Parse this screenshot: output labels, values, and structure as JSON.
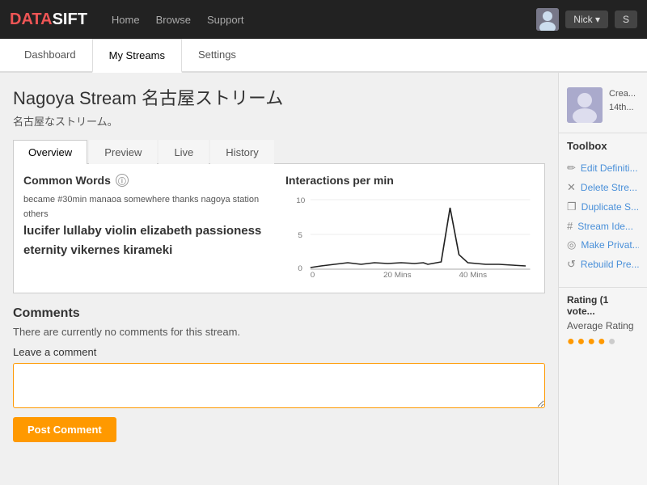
{
  "header": {
    "logo_data": "DATA",
    "logo_sift": "SIFT",
    "nav": [
      {
        "label": "Home",
        "id": "home"
      },
      {
        "label": "Browse",
        "id": "browse"
      },
      {
        "label": "Support",
        "id": "support"
      }
    ],
    "user_label": "Nick ▾",
    "search_placeholder": "Search..."
  },
  "main_tabs": [
    {
      "label": "Dashboard",
      "id": "dashboard",
      "active": false
    },
    {
      "label": "My Streams",
      "id": "my-streams",
      "active": true
    },
    {
      "label": "Settings",
      "id": "settings",
      "active": false
    }
  ],
  "page": {
    "title": "Nagoya Stream 名古屋ストリーム",
    "subtitle": "名古屋なストリーム。"
  },
  "inner_tabs": [
    {
      "label": "Overview",
      "id": "overview",
      "active": true
    },
    {
      "label": "Preview",
      "id": "preview",
      "active": false
    },
    {
      "label": "Live",
      "id": "live",
      "active": false
    },
    {
      "label": "History",
      "id": "history",
      "active": false
    }
  ],
  "overview": {
    "common_words_title": "Common Words",
    "word_cloud_text": "became #30min manaoa somewhere thanks nagoya station others",
    "word_cloud_highlight": "lucifer lullaby violin elizabeth passioness eternity vikernes kirameki",
    "interactions_title": "Interactions per min",
    "chart": {
      "y_labels": [
        "10",
        "5",
        "0"
      ],
      "x_labels": [
        "0",
        "20 Mins",
        "40 Mins"
      ],
      "data_points": [
        0,
        1,
        2,
        1,
        2,
        1,
        1,
        2,
        1,
        1,
        2,
        1,
        2,
        1,
        9,
        3,
        1,
        1,
        1,
        1
      ]
    }
  },
  "comments": {
    "title": "Comments",
    "no_comments_text": "There are currently no comments for this stream.",
    "leave_comment_label": "Leave a comment",
    "textarea_placeholder": "",
    "post_button_label": "Post Comment"
  },
  "sidebar": {
    "creator_label": "Crea...",
    "creator_date": "14th...",
    "toolbox_title": "Toolbox",
    "tools": [
      {
        "icon": "✏",
        "label": "Edit Definiti...",
        "id": "edit-definition"
      },
      {
        "icon": "✕",
        "label": "Delete Stre...",
        "id": "delete-stream"
      },
      {
        "icon": "❐",
        "label": "Duplicate S...",
        "id": "duplicate-stream"
      },
      {
        "icon": "#",
        "label": "Stream Ide...",
        "id": "stream-id"
      },
      {
        "icon": "◎",
        "label": "Make Privat...",
        "id": "make-private"
      },
      {
        "icon": "↺",
        "label": "Rebuild Pre...",
        "id": "rebuild-preview"
      }
    ],
    "rating_title": "Rating (1 vote...",
    "rating_avg_label": "Average Rating",
    "stars": [
      true,
      true,
      true,
      true,
      false
    ]
  }
}
